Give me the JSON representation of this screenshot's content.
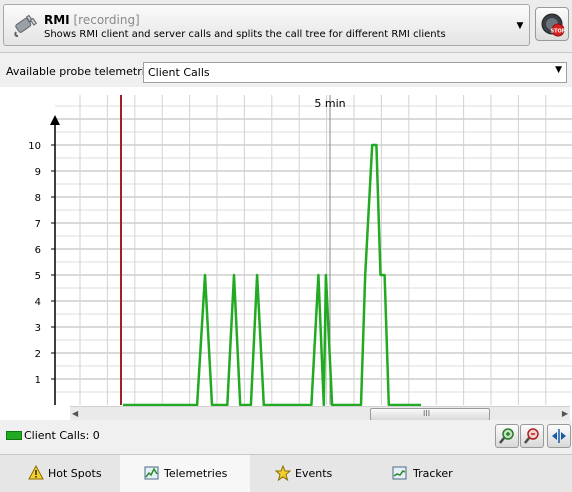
{
  "probe": {
    "name": "RMI",
    "status": "[recording]",
    "description": "Shows RMI client and server calls and splits the call tree for different RMI clients",
    "dropdown_icon": "caret-down",
    "stop_icon": "stop-recording"
  },
  "telemetry_selector": {
    "label": "Available probe telemetries:",
    "value": "Client Calls"
  },
  "chart_data": {
    "type": "line",
    "ylim": [
      0,
      11
    ],
    "yticks": [
      "1",
      "2",
      "3",
      "4",
      "5",
      "6",
      "7",
      "8",
      "9",
      "10"
    ],
    "time_marker_label": "5 min",
    "series": [
      {
        "name": "Client Calls",
        "color": "#22aa22",
        "points": [
          [
            0,
            0
          ],
          [
            1.79,
            0
          ],
          [
            1.98,
            5
          ],
          [
            2.15,
            0
          ],
          [
            2.52,
            0
          ],
          [
            2.68,
            5
          ],
          [
            2.83,
            0
          ],
          [
            3.09,
            0
          ],
          [
            3.24,
            5
          ],
          [
            3.4,
            0
          ],
          [
            4.55,
            0
          ],
          [
            4.72,
            5
          ],
          [
            4.85,
            0
          ],
          [
            4.9,
            5
          ],
          [
            5.05,
            0
          ],
          [
            5.75,
            0
          ],
          [
            5.85,
            5
          ],
          [
            6.02,
            10
          ],
          [
            6.12,
            10
          ],
          [
            6.22,
            5
          ],
          [
            6.32,
            5
          ],
          [
            6.42,
            0
          ],
          [
            7.2,
            0
          ]
        ]
      }
    ],
    "colors": {
      "series": "#22aa22",
      "start_marker": "#a0202a",
      "grid": "#d0d0d0"
    }
  },
  "scrollbar": {
    "left_icon": "scroll-left",
    "right_icon": "scroll-right",
    "grip": "III"
  },
  "legend": {
    "text": "Client Calls: 0",
    "color": "#22aa22"
  },
  "toolbar": {
    "zoom_in_icon": "zoom-in",
    "zoom_out_icon": "zoom-out",
    "fit_icon": "fit-width"
  },
  "tabs": [
    {
      "label": "Hot Spots",
      "icon": "warning-icon"
    },
    {
      "label": "Telemetries",
      "icon": "telemetry-icon",
      "active": true
    },
    {
      "label": "Events",
      "icon": "star-icon"
    },
    {
      "label": "Tracker",
      "icon": "tracker-icon"
    }
  ]
}
